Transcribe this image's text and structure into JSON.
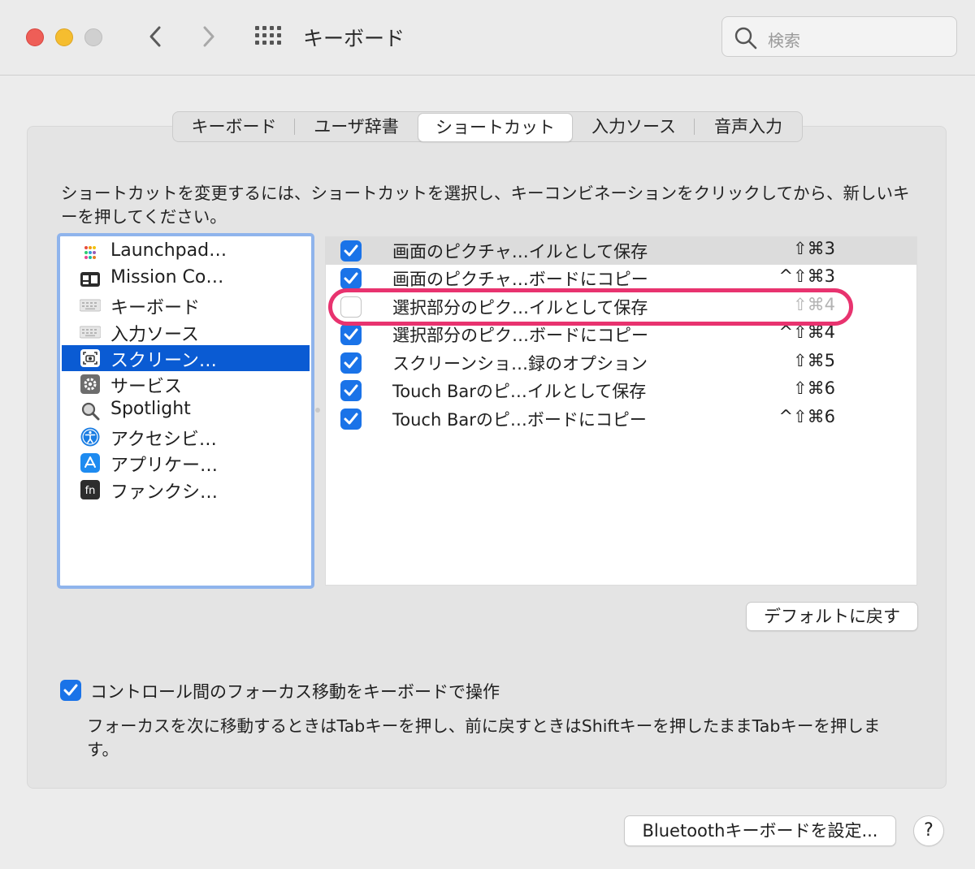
{
  "window": {
    "title": "キーボード",
    "search_placeholder": "検索"
  },
  "tabs": [
    {
      "label": "キーボード",
      "active": false
    },
    {
      "label": "ユーザ辞書",
      "active": false
    },
    {
      "label": "ショートカット",
      "active": true
    },
    {
      "label": "入力ソース",
      "active": false
    },
    {
      "label": "音声入力",
      "active": false
    }
  ],
  "description": "ショートカットを変更するには、ショートカットを選択し、キーコンビネーションをクリックしてから、新しいキーを押してください。",
  "categories": [
    {
      "label": "Launchpad…",
      "icon": "launchpad-icon"
    },
    {
      "label": "Mission Co…",
      "icon": "mission-control-icon"
    },
    {
      "label": "キーボード",
      "icon": "keyboard-icon"
    },
    {
      "label": "入力ソース",
      "icon": "keyboard-icon"
    },
    {
      "label": "スクリーン…",
      "icon": "screenshot-icon",
      "selected": true
    },
    {
      "label": "サービス",
      "icon": "gear-icon"
    },
    {
      "label": "Spotlight",
      "icon": "magnifier-icon"
    },
    {
      "label": "アクセシビ…",
      "icon": "accessibility-icon"
    },
    {
      "label": "アプリケー…",
      "icon": "app-store-icon"
    },
    {
      "label": "ファンクシ…",
      "icon": "fn-key-icon"
    }
  ],
  "shortcuts": [
    {
      "name": "画面のピクチャ…イルとして保存",
      "keys": "⇧⌘3",
      "checked": true
    },
    {
      "name": "画面のピクチャ…ボードにコピー",
      "keys": "^⇧⌘3",
      "checked": true
    },
    {
      "name": "選択部分のピク…イルとして保存",
      "keys": "⇧⌘4",
      "checked": false
    },
    {
      "name": "選択部分のピク…ボードにコピー",
      "keys": "^⇧⌘4",
      "checked": true
    },
    {
      "name": "スクリーンショ…録のオプション",
      "keys": "⇧⌘5",
      "checked": true
    },
    {
      "name": "Touch Barのピ…イルとして保存",
      "keys": "⇧⌘6",
      "checked": true
    },
    {
      "name": "Touch Barのピ…ボードにコピー",
      "keys": "^⇧⌘6",
      "checked": true
    }
  ],
  "default_button": "デフォルトに戻す",
  "keyboard_nav": {
    "label": "コントロール間のフォーカス移動をキーボードで操作",
    "checked": true,
    "note": "フォーカスを次に移動するときはTabキーを押し、前に戻すときはShiftキーを押したままTabキーを押します。"
  },
  "bluetooth_button": "Bluetoothキーボードを設定...",
  "help_button": "?",
  "colors": {
    "accent": "#1a73e8",
    "selection": "#0a5bd3",
    "annotation": "#e8336f"
  }
}
